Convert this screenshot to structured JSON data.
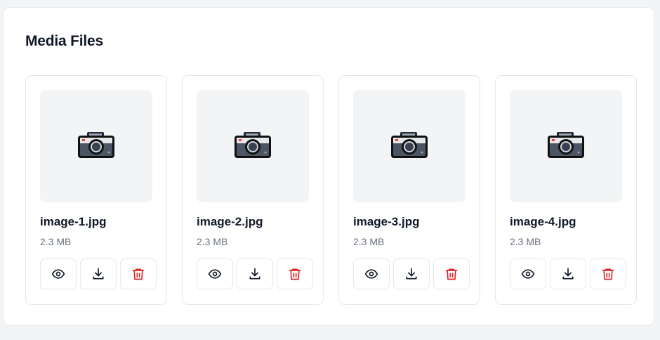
{
  "panel": {
    "title": "Media Files"
  },
  "files": [
    {
      "name": "image-1.jpg",
      "size": "2.3 MB",
      "thumbnail_icon": "camera-icon"
    },
    {
      "name": "image-2.jpg",
      "size": "2.3 MB",
      "thumbnail_icon": "camera-icon"
    },
    {
      "name": "image-3.jpg",
      "size": "2.3 MB",
      "thumbnail_icon": "camera-icon"
    },
    {
      "name": "image-4.jpg",
      "size": "2.3 MB",
      "thumbnail_icon": "camera-icon"
    }
  ],
  "actions": [
    {
      "icon": "eye-icon",
      "color": "#111827"
    },
    {
      "icon": "download-icon",
      "color": "#111827"
    },
    {
      "icon": "trash-icon",
      "color": "#dc2626"
    }
  ],
  "colors": {
    "background": "#f3f4f6",
    "panel": "#ffffff",
    "border": "#e5e7eb",
    "thumbnail_bg": "#f3f4f6",
    "danger": "#dc2626",
    "muted_text": "#6b7280"
  }
}
